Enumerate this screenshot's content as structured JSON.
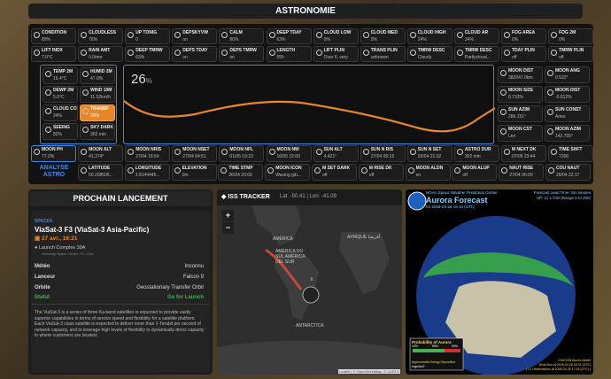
{
  "title": "ASTRONOMIE",
  "tiles_row1": [
    {
      "l": "CONDITION",
      "v": "80%"
    },
    {
      "l": "CLOUDLESS",
      "v": "76%"
    },
    {
      "l": "UP TONIG",
      "v": "0"
    },
    {
      "l": "DEPSKYVW",
      "v": "on"
    },
    {
      "l": "CALM",
      "v": "80%"
    },
    {
      "l": "DEEP TDAY",
      "v": "63%"
    },
    {
      "l": "CLOUD LOW",
      "v": "0%"
    },
    {
      "l": "CLOUD MED",
      "v": "0%"
    },
    {
      "l": "CLOUD HIGH",
      "v": "24%"
    },
    {
      "l": "CLOUD AR",
      "v": "24%"
    },
    {
      "l": "FOG AREA",
      "v": "0%"
    },
    {
      "l": "FOG 2M",
      "v": "0%"
    }
  ],
  "tiles_row2": [
    {
      "l": "LIFT INDX",
      "v": "7.0°C"
    },
    {
      "l": "RAIN AMT",
      "v": "0.0mm"
    },
    {
      "l": "DEEP TMRW",
      "v": "63%"
    },
    {
      "l": "DEPS TDAY",
      "v": "on"
    },
    {
      "l": "DEPS TMRW",
      "v": "on"
    },
    {
      "l": "LENGTH",
      "v": "55h"
    },
    {
      "l": "LIFT PLIN",
      "v": "Over 6, very"
    },
    {
      "l": "TRANS PLIN",
      "v": "unknown"
    },
    {
      "l": "TMRW DESC",
      "v": "Cloudy"
    },
    {
      "l": "TMRW DESC",
      "v": "Partlycloud..."
    },
    {
      "l": "TDAY PLIN",
      "v": "off"
    },
    {
      "l": "TMRW PLIN",
      "v": "off"
    }
  ],
  "left_tiles": [
    {
      "l": "TEMP 2M",
      "v": "16.4°C"
    },
    {
      "l": "HUMID 2M",
      "v": "47.0%"
    },
    {
      "l": "DEWP 2M",
      "v": "5.0°C"
    },
    {
      "l": "WIND 10M",
      "v": "11.52km/h"
    },
    {
      "l": "CLOUD COV",
      "v": "24%"
    },
    {
      "l": "TRANSP",
      "v": "26%"
    },
    {
      "l": "SEEING",
      "v": "82%"
    },
    {
      "l": "SKY DARK",
      "v": "302 min"
    }
  ],
  "right_tiles": [
    {
      "l": "MOON DIST",
      "v": "382047.0km"
    },
    {
      "l": "MOON ANG",
      "v": "0.522°"
    },
    {
      "l": "MOON SIZE",
      "v": "0.733%"
    },
    {
      "l": "MOON DIST",
      "v": "-0.612%"
    },
    {
      "l": "SUN AZIM",
      "v": "286.151°"
    },
    {
      "l": "SUN CONST",
      "v": "Aries"
    },
    {
      "l": "MOON CST",
      "v": "Leo"
    },
    {
      "l": "MOON AZIM",
      "v": "142.705°"
    }
  ],
  "chart_value": "26",
  "chart_unit": "%",
  "bottom_row1": [
    {
      "l": "MOON PH",
      "v": "77.2%"
    },
    {
      "l": "MOON ALT",
      "v": "41.374°"
    },
    {
      "l": "MOON NRIS",
      "v": "27/04 16:54"
    },
    {
      "l": "MOON NSET",
      "v": "27/04 04:51"
    },
    {
      "l": "MOON NFL",
      "v": "01/05 19:23"
    },
    {
      "l": "MOON NW",
      "v": "16/05 22:00"
    },
    {
      "l": "SUN ALT",
      "v": "4.421°"
    },
    {
      "l": "SUN N RIS",
      "v": "27/04 06:15"
    },
    {
      "l": "SUN N SET",
      "v": "26/04 21:32"
    },
    {
      "l": "ASTRO DUR",
      "v": "302 min"
    },
    {
      "l": "M NEXT DK",
      "v": "07/05 23:44"
    },
    {
      "l": "TIME SHFT",
      "v": "7200"
    }
  ],
  "bottom_row2": [
    {
      "l": "LATITUDE",
      "v": "50.208505..."
    },
    {
      "l": "LONGITUDE",
      "v": "3.8144445..."
    },
    {
      "l": "ELEVATION",
      "v": "0m"
    },
    {
      "l": "TIME STMP",
      "v": "26/04 20:00"
    },
    {
      "l": "MOON ICON",
      "v": "Waxing gib..."
    },
    {
      "l": "M SET DARK",
      "v": "off"
    },
    {
      "l": "M RISE DK",
      "v": "off"
    },
    {
      "l": "MOON ALDN",
      "v": "on"
    },
    {
      "l": "MOON ALUP",
      "v": "off"
    },
    {
      "l": "NAUT RISE",
      "v": "27/04 05:00"
    },
    {
      "l": "COU NAUT",
      "v": "26/04 22:17"
    }
  ],
  "analyse": "ANALYSE ASTRO",
  "launch": {
    "header": "PROCHAIN LANCEMENT",
    "agency": "SPACEX",
    "name": "ViaSat-3 F3 (ViaSat-3 Asia-Pacific)",
    "date": "27 avr., 16:21",
    "pad": "Launch Complex 39A",
    "pad_sub": "Kennedy Space Center, FL, USA",
    "meteo_l": "Météo",
    "meteo_v": "Inconnu",
    "lanceur_l": "Lanceur",
    "lanceur_v": "Falcon 9",
    "orbite_l": "Orbite",
    "orbite_v": "Geostationary Transfer Orbit",
    "statut_l": "Statut",
    "statut_v": "Go for Launch",
    "desc": "The ViaSat-3 is a series of three Ka-band satellites is expected to provide vastly superior capabilities in terms of service speed and flexibility for a satellite platform. Each ViaSat-3 class satellite is expected to deliver more than 1-Terabit per second of network capacity, and to leverage high levels of flexibility to dynamically direct capacity to where customers are located."
  },
  "iss": {
    "header": "ISS TRACKER",
    "coords": "Lat: -50.41 | Lon: -41.09",
    "zoom_in": "+",
    "zoom_out": "−",
    "label_america": "AMÉRICA",
    "label_sa": "AMÉRICA DO SUL AMÉRICA DEL SUR",
    "label_afr": "AFRIQUE أفريقيا",
    "label_ant": "ANTARCTICA",
    "attribution": "Leaflet | © OpenStreetMap, © CARTO"
  },
  "aurora": {
    "top": "NOAA Space Weather Prediction Center",
    "title": "Aurora Forecast",
    "sub": "for 2026-04-26 19:10 (UTC)",
    "lead": "Forecast Lead Time: 55 minutes",
    "hp": "HP: 11.1 GW (Range 5 to 200)",
    "prob": "Probability of Aurora",
    "p10": "10%",
    "p50": "50%",
    "p90": "90%",
    "energy": "Approximate Energy Deposition",
    "erg": "ergs/cm2",
    "model": "OVATION Aurora Model",
    "wind": "Wind Run at 2026-04-26 18:23 (UTC)",
    "obs": "( L1 Observations at 2026-04-26 17:29 (UTC) )"
  },
  "colors": {
    "accent": "#3a8be8",
    "orange": "#e8862a",
    "green": "#4caf50"
  }
}
